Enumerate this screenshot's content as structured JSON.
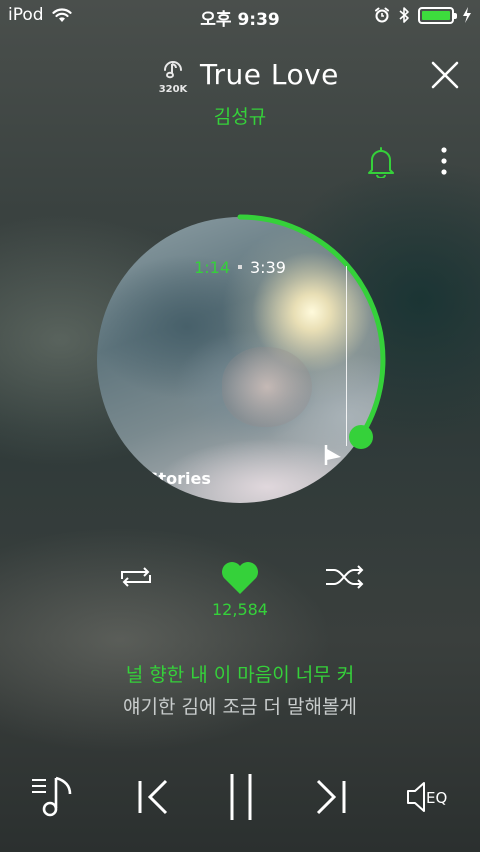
{
  "status_bar": {
    "device": "iPod",
    "time": "오후 9:39"
  },
  "header": {
    "quality_label": "320K",
    "title": "True Love",
    "artist": "김성규"
  },
  "album": {
    "overlay_text": "Stories",
    "current_time": "1:14",
    "total_time": "3:39",
    "progress_fraction": 0.34
  },
  "actions": {
    "like_count": "12,584"
  },
  "lyrics": {
    "current": "널 향한 내 이 마음이 너무 커",
    "next": "얘기한 김에 조금 더 말해볼게"
  },
  "controls": {
    "eq_label": "EQ"
  },
  "colors": {
    "accent": "#35d13a",
    "battery": "#3ddc3d"
  }
}
